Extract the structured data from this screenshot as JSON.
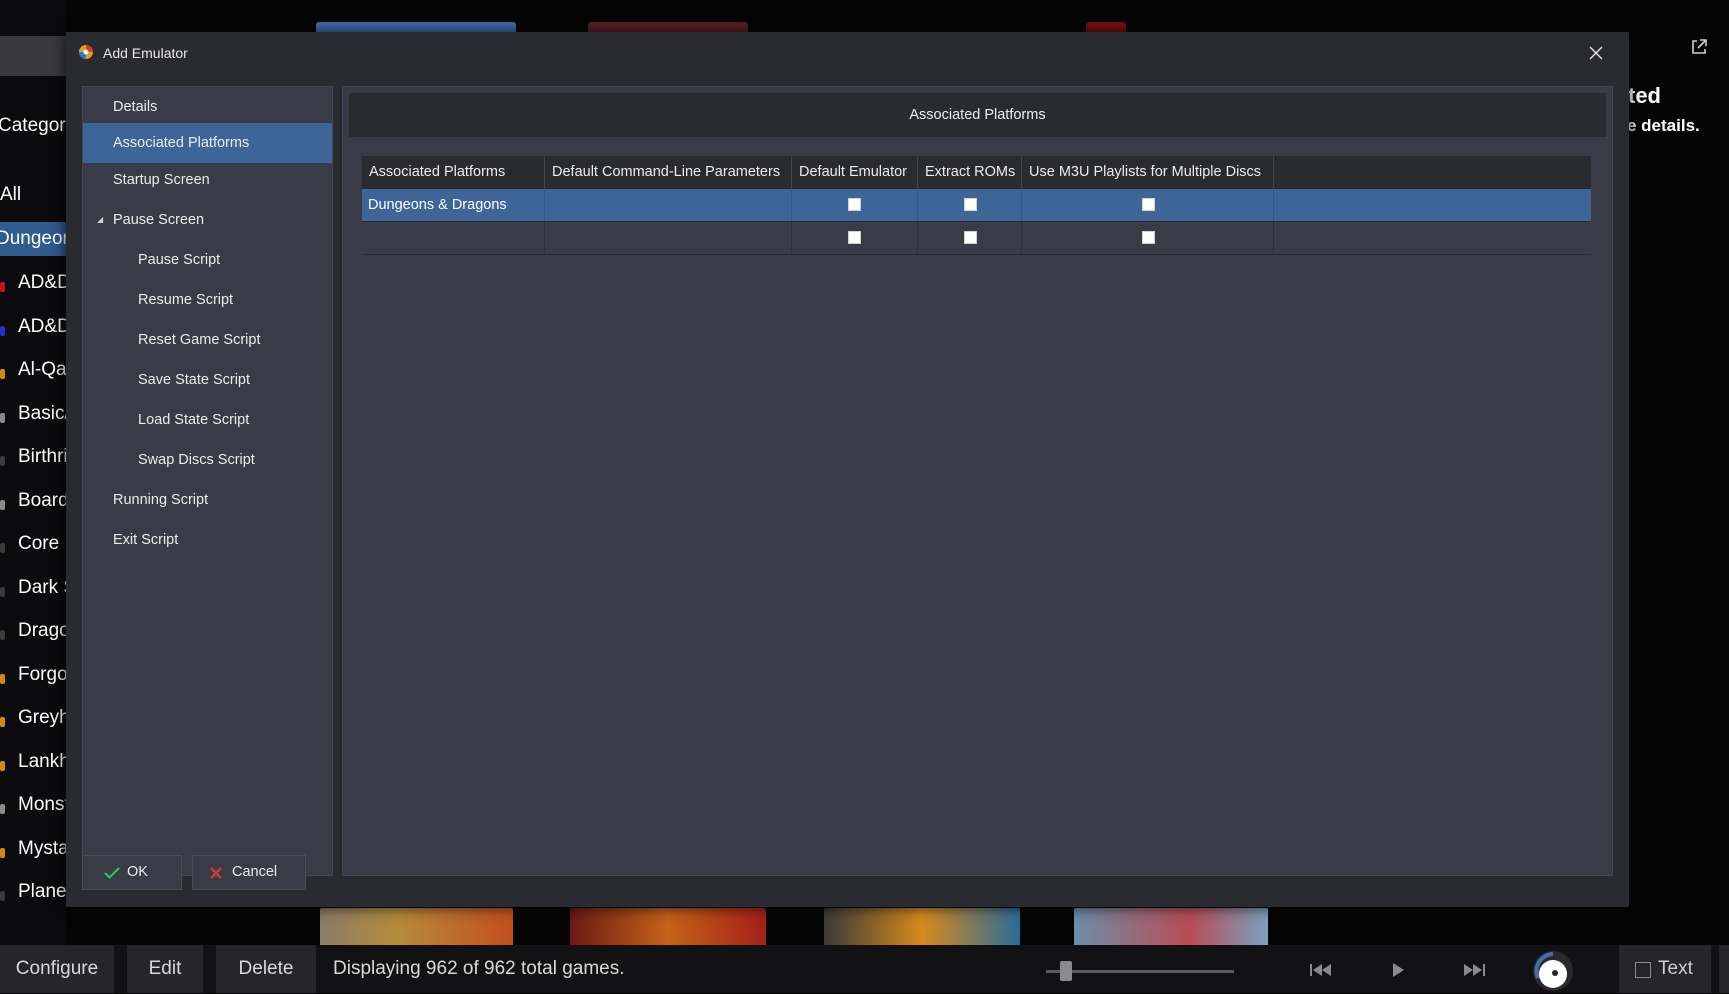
{
  "background": {
    "category_label": "Category",
    "all_label": "All",
    "selected_label": "Dungeon",
    "list_items": [
      "AD&D",
      "AD&D",
      "Al-Qa",
      "Basic/I",
      "Birthri",
      "Board",
      "Core F",
      "Dark S",
      "Drago",
      "Forgot",
      "Greyh",
      "Lankh",
      "Monst",
      "Mysta",
      "Planes"
    ],
    "right_text_line1": "ted",
    "right_text_line2": "e details."
  },
  "bottom_bar": {
    "configure_label": "Configure",
    "edit_label": "Edit",
    "delete_label": "Delete",
    "status_text": "Displaying 962 of 962 total games.",
    "text_toggle_label": "Text"
  },
  "dialog": {
    "title": "Add Emulator",
    "nav_items": [
      {
        "label": "Details"
      },
      {
        "label": "Associated Platforms"
      },
      {
        "label": "Startup Screen"
      },
      {
        "label": "Pause Screen"
      },
      {
        "label": "Pause Script"
      },
      {
        "label": "Resume Script"
      },
      {
        "label": "Reset Game Script"
      },
      {
        "label": "Save State Script"
      },
      {
        "label": "Load State Script"
      },
      {
        "label": "Swap Discs Script"
      },
      {
        "label": "Running Script"
      },
      {
        "label": "Exit Script"
      }
    ],
    "selected_nav": "Associated Platforms",
    "panel_header": "Associated Platforms",
    "table": {
      "columns": [
        "Associated Platforms",
        "Default Command-Line Parameters",
        "Default Emulator",
        "Extract ROMs",
        "Use M3U Playlists for Multiple Discs"
      ],
      "rows": [
        {
          "platform": "Dungeons & Dragons",
          "params": "",
          "default_emulator": false,
          "extract_roms": false,
          "use_m3u": false,
          "selected": true
        },
        {
          "platform": "",
          "params": "",
          "default_emulator": false,
          "extract_roms": false,
          "use_m3u": false,
          "selected": false
        }
      ]
    },
    "ok_label": "OK",
    "cancel_label": "Cancel"
  },
  "colors": {
    "accent": "#3d6598",
    "dialog_bg": "#2a2b31",
    "panel_bg": "#393c47",
    "ok_check": "#2ec45a",
    "cancel_x": "#d93a3a"
  }
}
